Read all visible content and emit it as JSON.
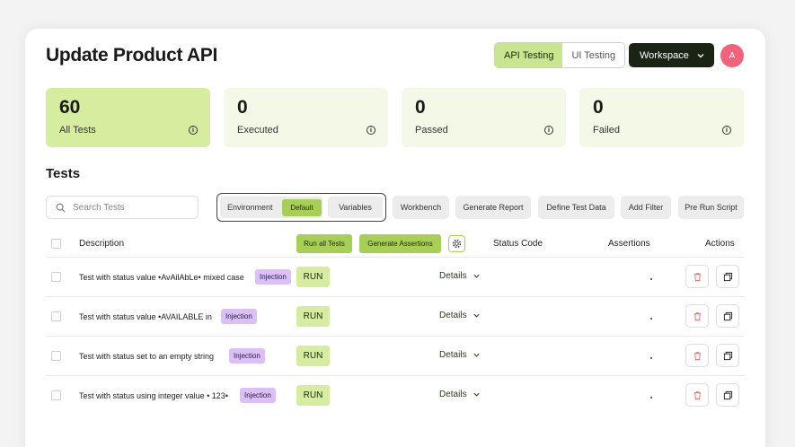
{
  "page": {
    "title": "Update Product API"
  },
  "header": {
    "api_testing_label": "API Testing",
    "ui_testing_label": "UI Testing",
    "workspace_label": "Workspace",
    "avatar_initial": "A"
  },
  "stats": [
    {
      "value": "60",
      "label": "All Tests"
    },
    {
      "value": "0",
      "label": "Executed"
    },
    {
      "value": "0",
      "label": "Passed"
    },
    {
      "value": "0",
      "label": "Failed"
    }
  ],
  "tests_section": {
    "heading": "Tests"
  },
  "toolbar": {
    "search_placeholder": "Search Tests",
    "environment_label": "Environment",
    "environment_value": "Default",
    "variables_label": "Variables",
    "workbench_label": "Workbench",
    "generate_report_label": "Generate Report",
    "define_test_data_label": "Define Test Data",
    "add_filter_label": "Add Filter",
    "pre_run_script_label": "Pre Run Script"
  },
  "table": {
    "col_description": "Description",
    "run_all_label": "Run all Tests",
    "generate_assertions_label": "Generate Assertions",
    "col_status_code": "Status Code",
    "col_assertions": "Assertions",
    "col_actions": "Actions",
    "rows": [
      {
        "description": "Test with status value •AvAilAbLe• mixed case",
        "tag": "Injection",
        "run": "RUN",
        "details": "Details",
        "assertions": "."
      },
      {
        "description": "Test with status value •AVAILABLE in",
        "tag": "Injection",
        "run": "RUN",
        "details": "Details",
        "assertions": "."
      },
      {
        "description": "Test with status set to an empty string",
        "tag": "Injection",
        "run": "RUN",
        "details": "Details",
        "assertions": "."
      },
      {
        "description": "Test with status using integer value • 123•",
        "tag": "Injection",
        "run": "RUN",
        "details": "Details",
        "assertions": "."
      }
    ]
  },
  "colors": {
    "accent": "#a8cf55",
    "accent_light": "#d6ec9f",
    "tag": "#dac0f7",
    "avatar": "#f2637b",
    "workspace_bg": "#1a2414"
  },
  "icons": [
    "info-icon",
    "search-icon",
    "gear-icon",
    "chevron-down-icon",
    "trash-icon",
    "copy-icon"
  ]
}
